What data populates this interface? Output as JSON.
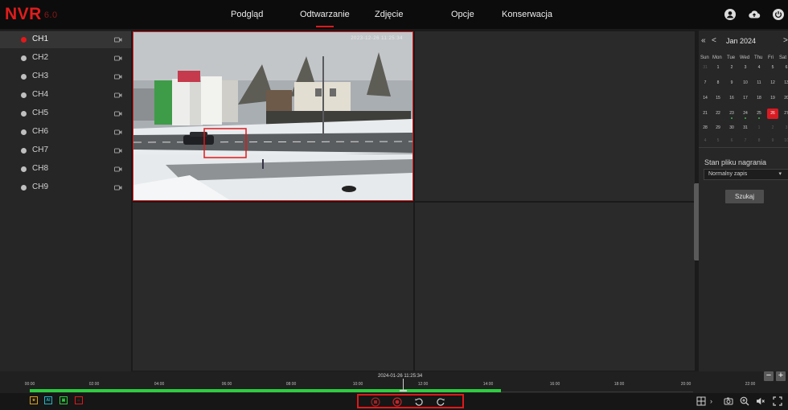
{
  "app": {
    "brand": "NVR",
    "version": "6.0"
  },
  "nav": [
    {
      "label": "Podgląd",
      "active": false
    },
    {
      "label": "Odtwarzanie",
      "active": true
    },
    {
      "label": "Zdjęcie",
      "active": false
    },
    {
      "label": "Opcje",
      "active": false
    },
    {
      "label": "Konserwacja",
      "active": false
    }
  ],
  "header_icons": [
    "user-icon",
    "cloud-upload-icon",
    "power-icon"
  ],
  "channels": [
    {
      "label": "CH1",
      "selected": true
    },
    {
      "label": "CH2",
      "selected": false
    },
    {
      "label": "CH3",
      "selected": false
    },
    {
      "label": "CH4",
      "selected": false
    },
    {
      "label": "CH5",
      "selected": false
    },
    {
      "label": "CH6",
      "selected": false
    },
    {
      "label": "CH7",
      "selected": false
    },
    {
      "label": "CH8",
      "selected": false
    },
    {
      "label": "CH9",
      "selected": false
    }
  ],
  "video": {
    "timestamp": "2023-12-26 11:25:34"
  },
  "calendar": {
    "prev_year": "«",
    "prev_month": "<",
    "next_month": ">",
    "month_label": "Jan",
    "year_label": "2024",
    "weekdays": [
      "Sun",
      "Mon",
      "Tue",
      "Wed",
      "Thu",
      "Fri",
      "Sat"
    ],
    "weeks": [
      [
        "31",
        "1",
        "2",
        "3",
        "4",
        "5",
        "6"
      ],
      [
        "7",
        "8",
        "9",
        "10",
        "11",
        "12",
        "13"
      ],
      [
        "14",
        "15",
        "16",
        "17",
        "18",
        "19",
        "20"
      ],
      [
        "21",
        "22",
        "23",
        "24",
        "25",
        "26",
        "27"
      ],
      [
        "28",
        "29",
        "30",
        "31",
        "1",
        "2",
        "3"
      ],
      [
        "4",
        "5",
        "6",
        "7",
        "8",
        "9",
        "10"
      ]
    ],
    "today": "26",
    "recorded_days": [
      "23",
      "24",
      "25",
      "26"
    ]
  },
  "record_state": {
    "label": "Stan pliku nagrania",
    "selected": "Normalny zapis"
  },
  "search_button": "Szukaj",
  "timeline": {
    "current_time": "2024-01-26 11:25:34",
    "ticks": [
      "00:00",
      "02:00",
      "04:00",
      "06:00",
      "08:00",
      "10:00",
      "12:00",
      "14:00",
      "16:00",
      "18:00",
      "20:00",
      "22:00"
    ],
    "zoom_out": "−",
    "zoom_in": "+"
  },
  "record_types": [
    {
      "label": "★",
      "color": "#d8a21a"
    },
    {
      "label": "AI",
      "color": "#1fb7c4"
    },
    {
      "label": "▣",
      "color": "#2ecc40"
    },
    {
      "label": "⌂",
      "color": "#e0191c"
    }
  ],
  "playback_controls": [
    "stop-icon",
    "record-icon",
    "rewind-icon",
    "forward-icon"
  ],
  "right_tools": [
    "layout-grid-icon",
    "camera-snapshot-icon",
    "zoom-in-icon",
    "volume-icon",
    "fullscreen-icon"
  ]
}
